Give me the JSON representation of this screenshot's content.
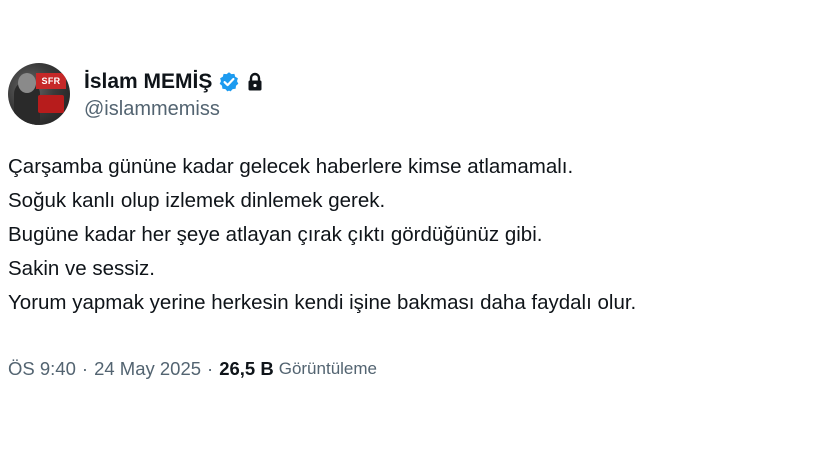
{
  "author": {
    "display_name": "İslam MEMİŞ",
    "handle": "@islammemiss",
    "avatar_sign_text": "SFR",
    "verified": true,
    "protected": true,
    "verified_badge_color": "#1d9bf0"
  },
  "tweet": {
    "lines": [
      "Çarşamba gününe kadar gelecek haberlere kimse atlamamalı.",
      "Soğuk kanlı olup izlemek dinlemek gerek.",
      "Bugüne kadar her şeye atlayan çırak çıktı gördüğünüz gibi.",
      "Sakin ve sessiz.",
      "Yorum yapmak yerine herkesin kendi işine bakması daha faydalı olur."
    ]
  },
  "meta": {
    "time": "ÖS 9:40",
    "separator": "·",
    "date": "24 May 2025",
    "view_count": "26,5 B",
    "views_label": "Görüntüleme"
  },
  "colors": {
    "text_primary": "#0f1419",
    "text_secondary": "#536471",
    "background": "#ffffff"
  }
}
